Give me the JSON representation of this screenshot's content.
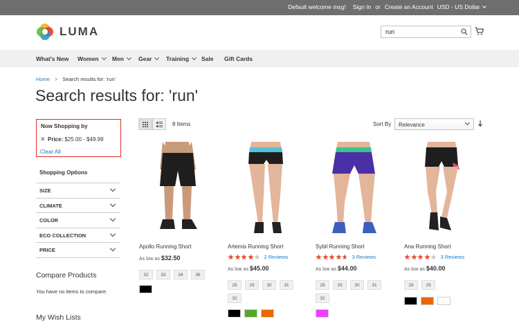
{
  "topbar": {
    "welcome": "Default welcome msg!",
    "sign_in": "Sign In",
    "or": "or",
    "create_account": "Create an Account",
    "currency": "USD - US Dollar"
  },
  "header": {
    "brand": "LUMA",
    "search_value": "run"
  },
  "nav": [
    {
      "label": "What's New",
      "has_menu": false
    },
    {
      "label": "Women",
      "has_menu": true
    },
    {
      "label": "Men",
      "has_menu": true
    },
    {
      "label": "Gear",
      "has_menu": true
    },
    {
      "label": "Training",
      "has_menu": true
    },
    {
      "label": "Sale",
      "has_menu": false
    },
    {
      "label": "Gift Cards",
      "has_menu": false
    }
  ],
  "breadcrumb": {
    "home": "Home",
    "separator": ">",
    "current": "Search results for: 'run'"
  },
  "page_title": "Search results for: 'run'",
  "now_shopping": {
    "heading": "Now Shopping by",
    "remove": "✕",
    "filter_label": "Price:",
    "filter_value": "$25.00 - $49.99",
    "clear_all": "Clear All"
  },
  "shopping_options": {
    "heading": "Shopping Options",
    "facets": [
      "SIZE",
      "CLIMATE",
      "COLOR",
      "ECO COLLECTION",
      "PRICE"
    ]
  },
  "compare": {
    "heading": "Compare Products",
    "text": "You have no items to compare."
  },
  "wishlist": {
    "heading": "My Wish Lists"
  },
  "toolbar": {
    "count": "8 Items",
    "sort_label": "Sort By",
    "sort_value": "Relevance"
  },
  "products": [
    {
      "name": "Apollo Running Short",
      "rating_pct": null,
      "reviews": "",
      "price_prefix": "As low as",
      "price": "$32.50",
      "sizes": [
        "32",
        "33",
        "34",
        "36"
      ],
      "colors": [
        "#000000"
      ]
    },
    {
      "name": "Artemis Running Short",
      "rating_pct": 80,
      "reviews": "2 Reviews",
      "price_prefix": "As low as",
      "price": "$45.00",
      "sizes": [
        "28",
        "29",
        "30",
        "31",
        "32"
      ],
      "colors": [
        "#000000",
        "#53a828",
        "#eb6703"
      ]
    },
    {
      "name": "Sybil Running Short",
      "rating_pct": 93,
      "reviews": "3 Reviews",
      "price_prefix": "As low as",
      "price": "$44.00",
      "sizes": [
        "28",
        "29",
        "30",
        "31",
        "32"
      ],
      "colors": [
        "#ef3dff"
      ]
    },
    {
      "name": "Ana Running Short",
      "rating_pct": 80,
      "reviews": "3 Reviews",
      "price_prefix": "As low as",
      "price": "$40.00",
      "sizes": [
        "28",
        "29"
      ],
      "colors": [
        "#000000",
        "#eb6703",
        "#ffffff"
      ]
    }
  ],
  "colors": {
    "topbar": "#6e6e6e",
    "nav": "#f0f0f0",
    "link": "#1979c3",
    "highlight_border": "#e02b27",
    "star": "#e84a30"
  }
}
